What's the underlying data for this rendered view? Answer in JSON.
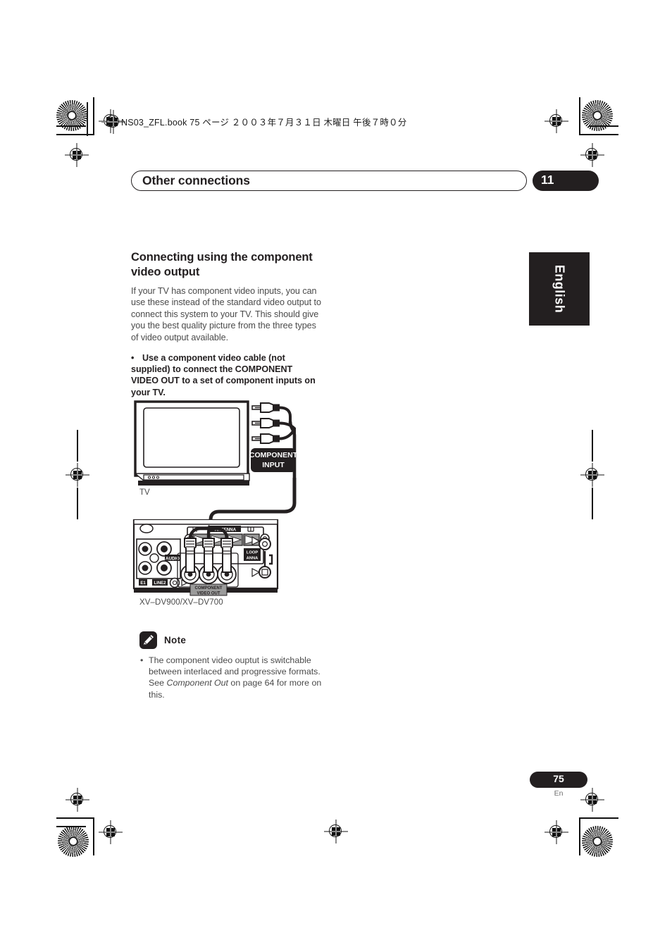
{
  "print_marks": {
    "book_slug": "NS03_ZFL.book  75 ページ  ２００３年７月３１日   木曜日   午後７時０分",
    "star_target_name": "registration-star-target",
    "crosshair_name": "registration-crosshair"
  },
  "header": {
    "chapter_title": "Other connections",
    "chapter_number": "11"
  },
  "side_tab": {
    "language": "English"
  },
  "main": {
    "section_title": "Connecting using the component video output",
    "intro_paragraph": "If your TV has component video inputs, you can use these instead of the standard video output to connect this system to your TV. This should give you the best quality picture from the three types of video output available.",
    "bullet_marker": "•",
    "instruction": "Use a component video cable (not supplied) to connect the COMPONENT VIDEO OUT to a set of component inputs on your TV."
  },
  "diagram": {
    "tv_label": "TV",
    "tv_input_label_line1": "COMPONENT",
    "tv_input_label_line2": "INPUT",
    "model_label": "XV–DV900/XV–DV700",
    "rear_panel": {
      "antenna_label": "ANTENNA",
      "loop_antenna_label_line1": "LOOP",
      "loop_antenna_label_line2": "ANNA",
      "component_out_line1": "COMPONENT",
      "component_out_line2": "VIDEO OUT",
      "audio_label": "AUDIO",
      "line1_label": "E1",
      "line2_label": "LINE2"
    }
  },
  "note": {
    "icon_name": "pencil-icon",
    "label": "Note",
    "bullet": "•",
    "text_part1": "The component video ouptut is switchable between interlaced and progressive formats. See ",
    "text_italic": "Component Out",
    "text_part2": " on page 64 for more on this."
  },
  "footer": {
    "page_number": "75",
    "page_language": "En"
  },
  "colors": {
    "ink": "#231f20",
    "body_gray": "#4a4a4a",
    "white": "#ffffff"
  }
}
